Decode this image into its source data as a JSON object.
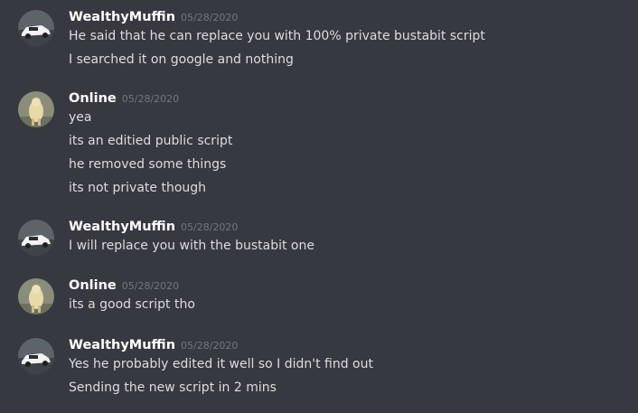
{
  "messages": [
    {
      "author": "WealthyMuffin",
      "timestamp": "05/28/2020",
      "avatar": "car-avatar",
      "lines": [
        "He said that he can replace you with 100% private bustabit script",
        "I searched it on google and nothing"
      ]
    },
    {
      "author": "Online",
      "timestamp": "05/28/2020",
      "avatar": "animal-avatar",
      "lines": [
        "yea",
        "its an editied public script",
        "he removed some things",
        "its not private though"
      ]
    },
    {
      "author": "WealthyMuffin",
      "timestamp": "05/28/2020",
      "avatar": "car-avatar",
      "lines": [
        "I will replace you with the bustabit one"
      ]
    },
    {
      "author": "Online",
      "timestamp": "05/28/2020",
      "avatar": "animal-avatar",
      "lines": [
        "its a good script tho"
      ]
    },
    {
      "author": "WealthyMuffin",
      "timestamp": "05/28/2020",
      "avatar": "car-avatar",
      "lines": [
        "Yes he probably edited it well so I didn't find out",
        "Sending the new script in 2 mins"
      ]
    }
  ],
  "colors": {
    "background": "#36393f",
    "username": "#ffffff",
    "timestamp": "#72767d",
    "message_text": "#dcddde"
  }
}
